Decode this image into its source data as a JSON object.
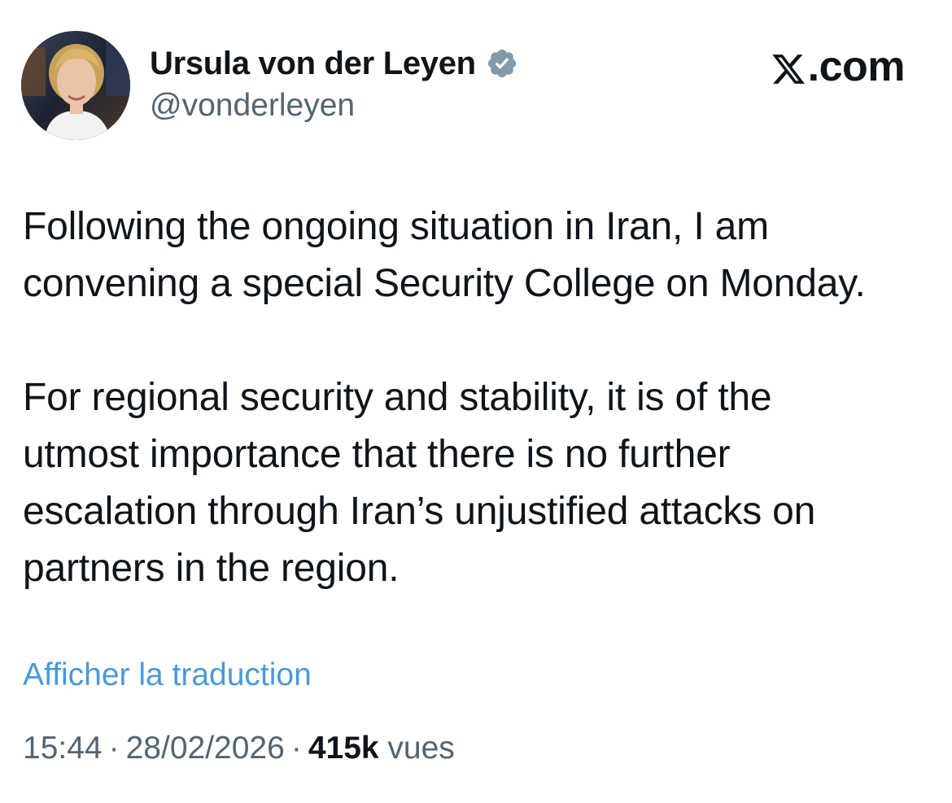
{
  "author": {
    "name": "Ursula von der Leyen",
    "handle": "@vonderleyen",
    "verified_icon": "verified-badge-icon"
  },
  "brand": {
    "logo_icon": "x-logo-icon",
    "suffix": ".com"
  },
  "tweet": {
    "paragraph1": [
      "Following the ongoing situation in Iran, I am",
      "convening a special Security College on Monday."
    ],
    "paragraph2": [
      "For regional security and stability, it is of the",
      "utmost importance that there is no further",
      "escalation through Iran’s unjustified attacks on",
      "partners in the region."
    ],
    "translate_link": "Afficher la traduction"
  },
  "meta": {
    "time": "15:44",
    "separator": "·",
    "date": "28/02/2026",
    "views_count": "415k",
    "views_label": "vues"
  },
  "colors": {
    "text": "#0f1419",
    "secondary": "#536471",
    "link": "#4a99d8",
    "verified": "#829aab"
  }
}
